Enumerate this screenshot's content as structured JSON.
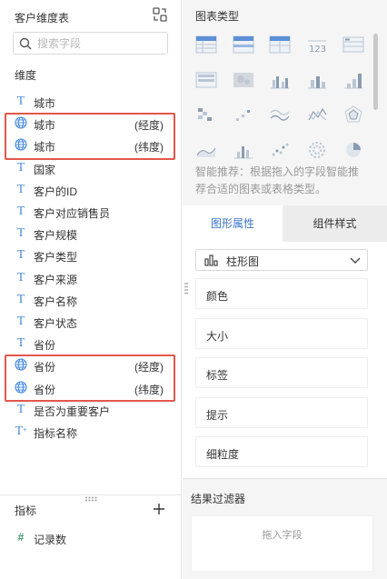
{
  "left_panel": {
    "title": "客户维度表",
    "search_placeholder": "搜索字段",
    "dimensions_label": "维度",
    "dimensions": [
      {
        "name": "城市",
        "tag": "",
        "type": "text"
      },
      {
        "name": "城市",
        "tag": "(经度)",
        "type": "geo"
      },
      {
        "name": "城市",
        "tag": "(纬度)",
        "type": "geo"
      },
      {
        "name": "国家",
        "tag": "",
        "type": "text"
      },
      {
        "name": "客户的ID",
        "tag": "",
        "type": "text"
      },
      {
        "name": "客户对应销售员",
        "tag": "",
        "type": "text"
      },
      {
        "name": "客户规模",
        "tag": "",
        "type": "text"
      },
      {
        "name": "客户类型",
        "tag": "",
        "type": "text"
      },
      {
        "name": "客户来源",
        "tag": "",
        "type": "text"
      },
      {
        "name": "客户名称",
        "tag": "",
        "type": "text"
      },
      {
        "name": "客户状态",
        "tag": "",
        "type": "text"
      },
      {
        "name": "省份",
        "tag": "",
        "type": "text"
      },
      {
        "name": "省份",
        "tag": "(经度)",
        "type": "geo"
      },
      {
        "name": "省份",
        "tag": "(纬度)",
        "type": "geo"
      },
      {
        "name": "是否为重要客户",
        "tag": "",
        "type": "text"
      },
      {
        "name": "指标名称",
        "tag": "",
        "type": "text-measure"
      }
    ],
    "measures_label": "指标",
    "measures": [
      {
        "name": "记录数",
        "icon_text": "#"
      }
    ]
  },
  "right_panel": {
    "chart_type_title": "图表类型",
    "chart_icons": [
      "table-detail",
      "table-group",
      "table-cross",
      "kpi-number",
      "table-list",
      "table-flat",
      "heatmap",
      "bar-grouped",
      "bar-stacked",
      "bar-sorted",
      "waterfall",
      "scatter-step",
      "line-multi",
      "line-radar",
      "radar",
      "area",
      "bar-mini",
      "scatter",
      "sunburst",
      "pie"
    ],
    "hint": "智能推荐：根据拖入的字段智能推荐合适的图表或表格类型。",
    "tabs": [
      "图形属性",
      "组件样式"
    ],
    "chart_select_value": "柱形图",
    "properties": [
      "颜色",
      "大小",
      "标签",
      "提示",
      "细粒度"
    ],
    "filter_title": "结果过滤器",
    "filter_drop_hint": "拖入字段"
  },
  "colors": {
    "accent": "#3a74c9",
    "highlight": "#e2584b",
    "dimension_icon": "#4a8cdf",
    "measure_icon": "#3b9c6a"
  }
}
